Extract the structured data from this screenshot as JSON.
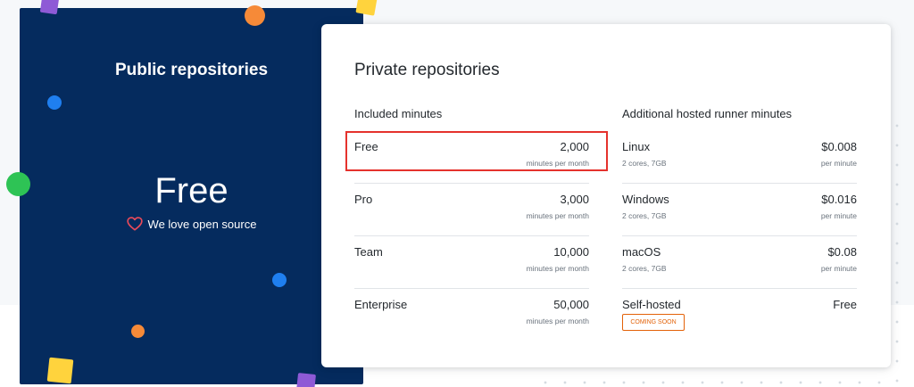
{
  "public": {
    "title": "Public repositories",
    "price": "Free",
    "tagline": "We love open source"
  },
  "private": {
    "title": "Private repositories",
    "included": {
      "heading": "Included minutes",
      "rows": [
        {
          "label": "Free",
          "value": "2,000",
          "unit": "minutes per month"
        },
        {
          "label": "Pro",
          "value": "3,000",
          "unit": "minutes per month"
        },
        {
          "label": "Team",
          "value": "10,000",
          "unit": "minutes per month"
        },
        {
          "label": "Enterprise",
          "value": "50,000",
          "unit": "minutes per month"
        }
      ]
    },
    "additional": {
      "heading": "Additional hosted runner minutes",
      "rows": [
        {
          "label": "Linux",
          "spec": "2 cores, 7GB",
          "value": "$0.008",
          "unit": "per minute"
        },
        {
          "label": "Windows",
          "spec": "2 cores, 7GB",
          "value": "$0.016",
          "unit": "per minute"
        },
        {
          "label": "macOS",
          "spec": "2 cores, 7GB",
          "value": "$0.08",
          "unit": "per minute"
        },
        {
          "label": "Self-hosted",
          "badge": "COMING SOON",
          "value": "Free"
        }
      ]
    }
  },
  "colors": {
    "panel_bg": "#052b5e",
    "highlight": "#e5322d",
    "badge": "#e36209",
    "heart": "#ea4a5a"
  },
  "icons": {
    "heart": "heart-icon"
  }
}
